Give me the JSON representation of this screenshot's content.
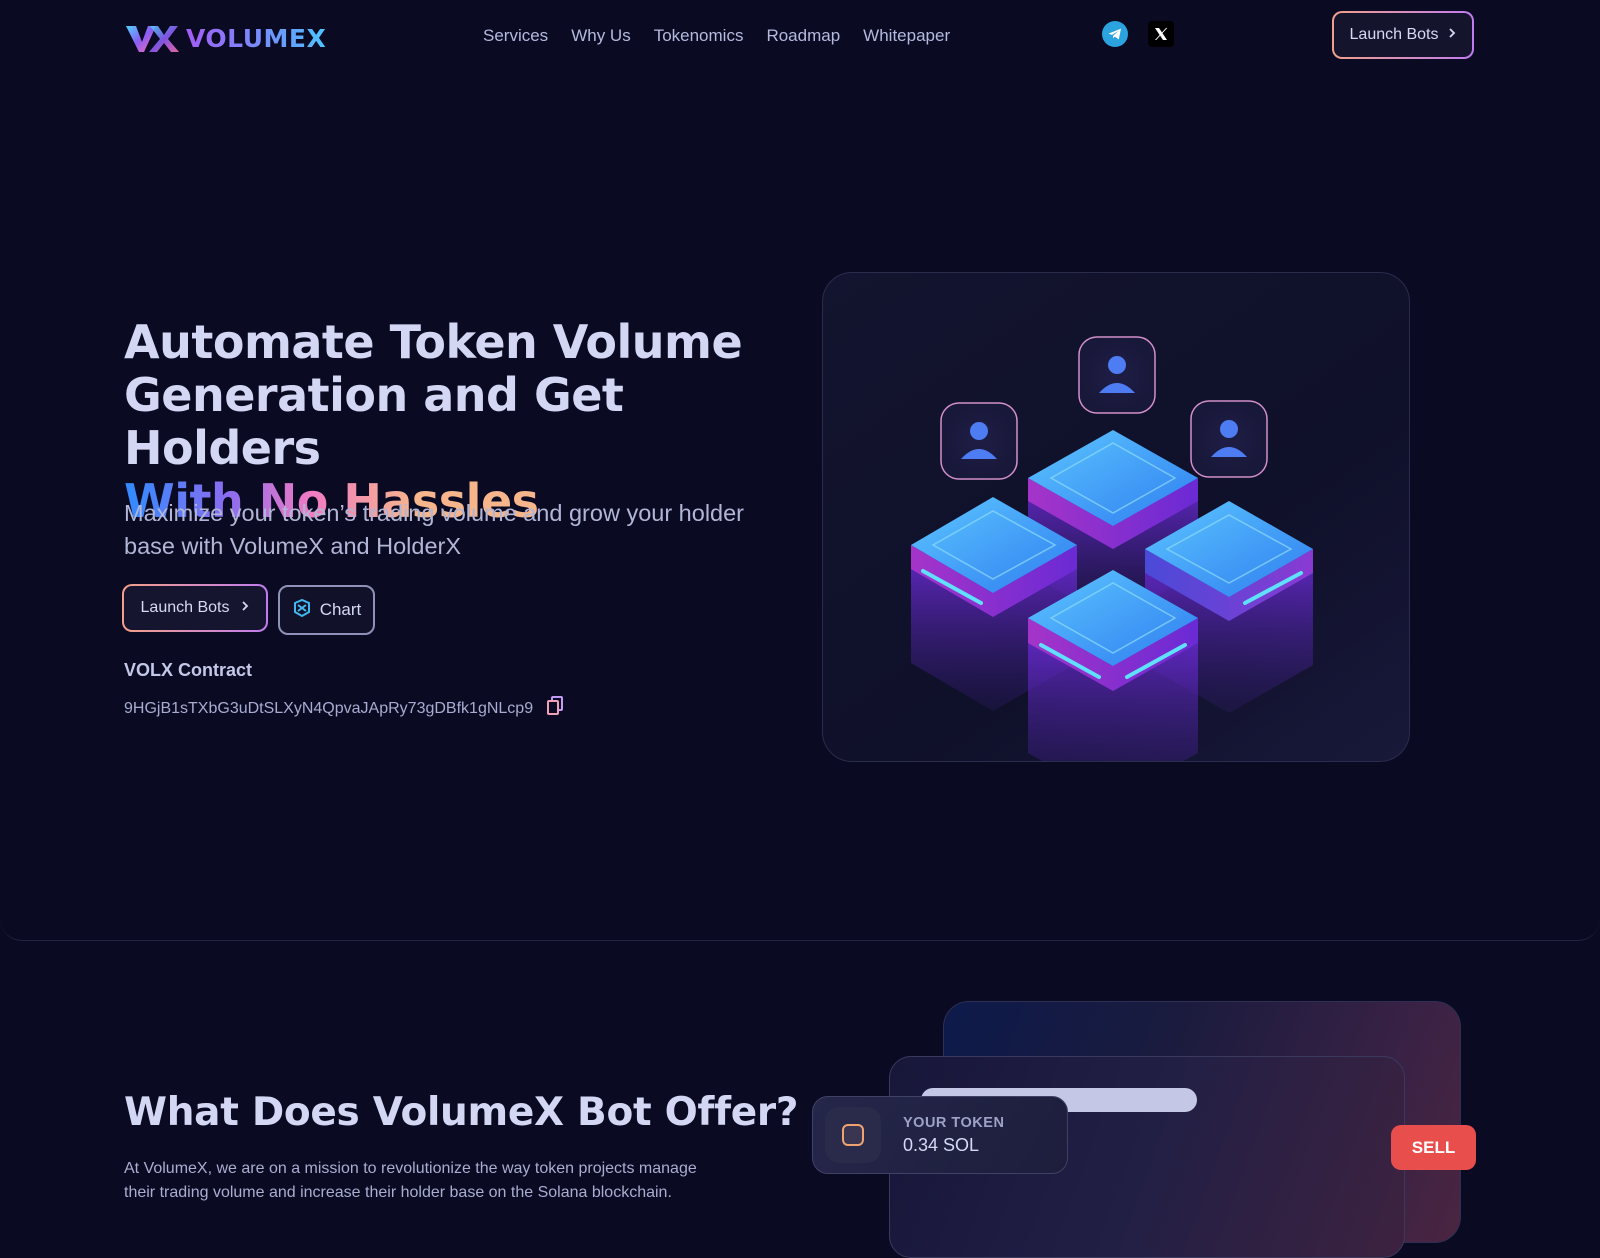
{
  "header": {
    "logo_text": "VOLUMEX",
    "nav": [
      "Services",
      "Why Us",
      "Tokenomics",
      "Roadmap",
      "Whitepaper"
    ],
    "social_icons": [
      "telegram-icon",
      "x-icon"
    ],
    "launch_label": "Launch Bots"
  },
  "hero": {
    "title_line1": "Automate Token Volume",
    "title_line2": "Generation and Get Holders",
    "title_line3": "With No Hassles",
    "subtitle": "Maximize your token’s trading volume and grow your holder base with VolumeX and HolderX",
    "launch_label": "Launch Bots",
    "chart_label": "Chart",
    "contract_label": "VOLX Contract",
    "contract_address": "9HGjB1sTXbG3uDtSLXyN4QpvaJApRy73gDBfk1gNLcp9"
  },
  "offer": {
    "title": "What Does VolumeX Bot Offer?",
    "text": "At VolumeX, we are on a mission to revolutionize the way token projects manage their trading volume and increase their holder base on the Solana blockchain.",
    "token_label": "YOUR TOKEN",
    "token_value": "0.34 SOL",
    "sell_label": "SELL"
  },
  "colors": {
    "background": "#0a0a23",
    "accent_peach": "#f3a088",
    "accent_purple": "#c07cf0",
    "accent_blue": "#2f8cff",
    "sell_red": "#e84e4c"
  }
}
